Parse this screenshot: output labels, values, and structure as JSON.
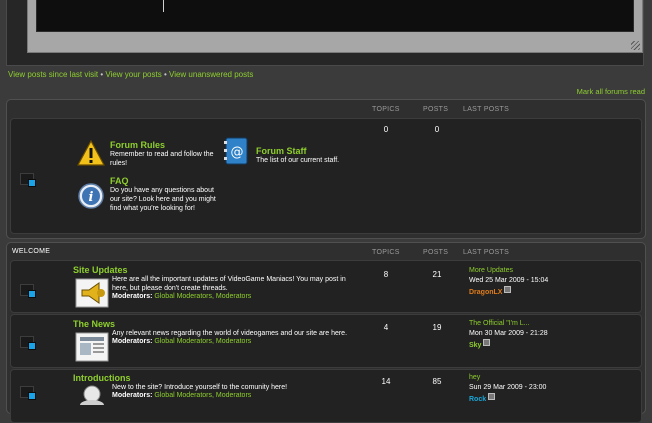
{
  "quicklinks": {
    "since_last": "View posts since last visit",
    "your_posts": "View your posts",
    "unanswered": "View unanswered posts",
    "separator": "•"
  },
  "mark_all_read": "Mark all forums read",
  "info_block": {
    "head": {
      "topics": "TOPICS",
      "posts": "POSTS",
      "last_posts": "LAST POSTS"
    },
    "topics": "0",
    "posts": "0",
    "forums": [
      {
        "title": "Forum Rules",
        "desc": "Remember to read and follow the rules!",
        "icon": "warning-icon"
      },
      {
        "title": "Forum Staff",
        "desc": "The list of our current staff.",
        "icon": "address-book-icon"
      },
      {
        "title": "FAQ",
        "desc": "Do you have any questions about our site? Look here and you might find what you're looking for!",
        "icon": "info-icon"
      }
    ]
  },
  "welcome": {
    "category": "WELCOME",
    "head": {
      "topics": "TOPICS",
      "posts": "POSTS",
      "last_posts": "LAST POSTS"
    },
    "moderators_label": "Moderators:",
    "forums": [
      {
        "title": "Site Updates",
        "desc": "Here are all the important updates of VideoGame Maniacs! You may post in here, but please don't create threads.",
        "moderators": "Global Moderators, Moderators",
        "topics": "8",
        "posts": "21",
        "last_title": "More Updates",
        "last_date": "Wed 25 Mar 2009 - 15:04",
        "last_user": "DragonLX",
        "user_color": "#e07b1a",
        "icon": "megaphone-icon"
      },
      {
        "title": "The News",
        "desc": "Any relevant news regarding the world of videogames and our site are here.",
        "moderators": "Global Moderators, Moderators",
        "topics": "4",
        "posts": "19",
        "last_title": "The Official \"I'm L...",
        "last_date": "Mon 30 Mar 2009 - 21:28",
        "last_user": "Sky",
        "user_color": "#8ecf2e",
        "icon": "newspaper-icon"
      },
      {
        "title": "Introductions",
        "desc": "New to the site? Introduce yourself to the comunity here!",
        "moderators": "Global Moderators, Moderators",
        "topics": "14",
        "posts": "85",
        "last_title": "hey",
        "last_date": "Sun 29 Mar 2009 - 23:00",
        "last_user": "Rock",
        "user_color": "#19a7d8",
        "icon": "person-icon"
      }
    ]
  },
  "colors": {
    "accent": "#8ecf2e",
    "background": "#3b3b3b",
    "panel": "#2f2f2f",
    "folder_dot": "#1aa3e6"
  }
}
